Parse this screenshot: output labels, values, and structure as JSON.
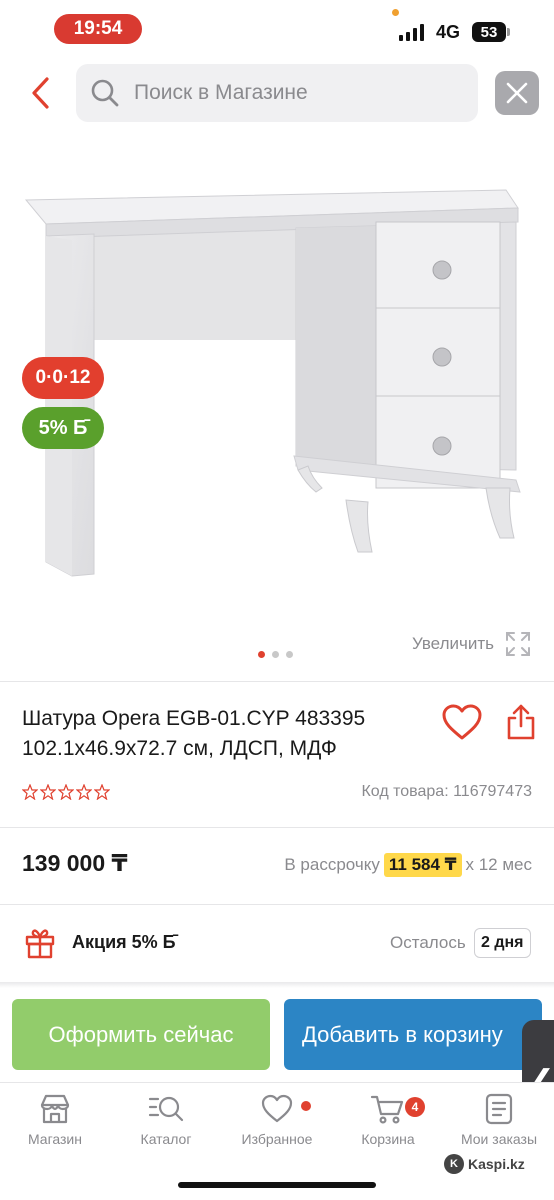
{
  "status_bar": {
    "time": "19:54",
    "network": "4G",
    "battery": "53"
  },
  "header": {
    "search_placeholder": "Поиск в Магазине"
  },
  "gallery": {
    "badge_installment": "0·0·12",
    "badge_bonus": "5% Б̄",
    "zoom_label": "Увеличить",
    "dots": 3,
    "active_dot": 0
  },
  "product": {
    "title": "Шатура Opera EGB-01.CYP 483395 102.1x46.9x72.7 см, ЛДСП, МДФ",
    "rating": 0,
    "code_label": "Код товара:",
    "code_value": "116797473",
    "price": "139 000 ₸",
    "installment_prefix": "В рассрочку",
    "installment_monthly": "11 584 ₸",
    "installment_suffix": "x 12 мес"
  },
  "promo": {
    "label": "Акция 5% Б̄",
    "left_label": "Осталось",
    "left_days": "2 дня"
  },
  "actions": {
    "buy_now": "Оформить сейчас",
    "add_to_cart": "Добавить в корзину"
  },
  "nav": {
    "items": [
      {
        "label": "Магазин",
        "icon": "store-icon"
      },
      {
        "label": "Каталог",
        "icon": "catalog-search-icon"
      },
      {
        "label": "Избранное",
        "icon": "heart-icon"
      },
      {
        "label": "Корзина",
        "icon": "cart-icon"
      },
      {
        "label": "Мои заказы",
        "icon": "orders-icon"
      }
    ],
    "cart_count": "4"
  },
  "watermark": "Kaspi.kz",
  "colors": {
    "accent_red": "#e0412f",
    "buy_green": "#92cc6b",
    "cart_blue": "#2c85c5",
    "bonus_green": "#5aa02c",
    "installment_yellow": "#ffd84a"
  }
}
